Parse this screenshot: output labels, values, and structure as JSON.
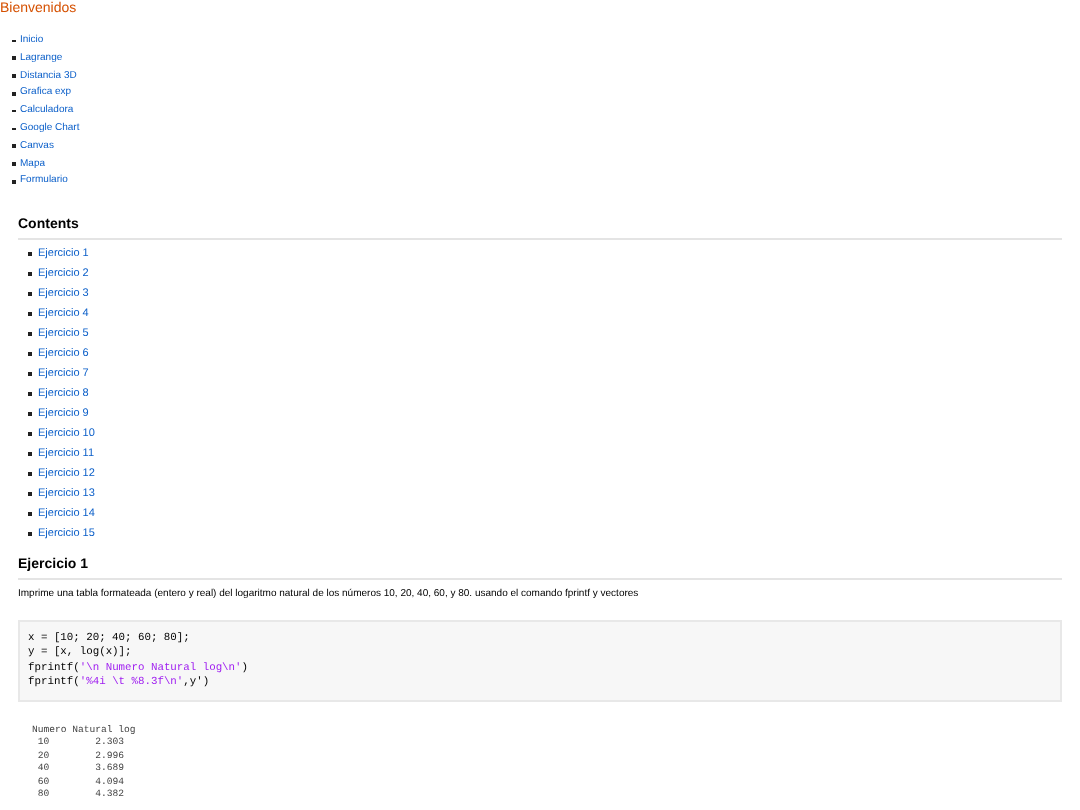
{
  "title": "Bienvenidos",
  "nav": [
    "Inicio",
    "Lagrange",
    "Distancia 3D",
    "Grafica exp",
    "Calculadora",
    "Google Chart",
    "Canvas",
    "Mapa",
    "Formulario"
  ],
  "contents": {
    "heading": "Contents",
    "items": [
      "Ejercicio 1",
      "Ejercicio 2",
      "Ejercicio 3",
      "Ejercicio 4",
      "Ejercicio 5",
      "Ejercicio 6",
      "Ejercicio 7",
      "Ejercicio 8",
      "Ejercicio 9",
      "Ejercicio 10",
      "Ejercicio 11",
      "Ejercicio 12",
      "Ejercicio 13",
      "Ejercicio 14",
      "Ejercicio 15"
    ]
  },
  "section": {
    "heading": "Ejercicio 1",
    "description": "Imprime una tabla formateada (entero y real) del logaritmo natural de los números 10, 20, 40, 60, y 80. usando el comando fprintf y vectores",
    "code": [
      [
        {
          "kind": "plain",
          "text": "x = [10; 20; 40; 60; 80];"
        }
      ],
      [
        {
          "kind": "plain",
          "text": "y = [x, log(x)];"
        }
      ],
      [
        {
          "kind": "plain",
          "text": "fprintf("
        },
        {
          "kind": "string",
          "text": "'\\n Numero Natural log\\n'"
        },
        {
          "kind": "plain",
          "text": ")"
        }
      ],
      [
        {
          "kind": "plain",
          "text": "fprintf("
        },
        {
          "kind": "string",
          "text": "'%4i \\t %8.3f\\n'"
        },
        {
          "kind": "plain",
          "text": ",y')"
        }
      ]
    ],
    "output": "Numero Natural log\n 10        2.303\n 20        2.996\n 40        3.689\n 60        4.094\n 80        4.382"
  }
}
